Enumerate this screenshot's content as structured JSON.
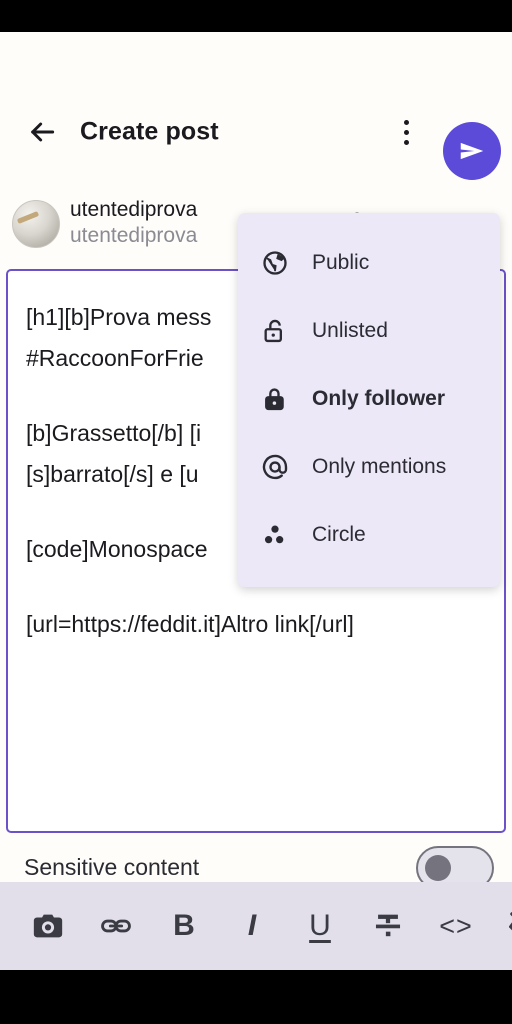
{
  "app": {
    "title": "Create post"
  },
  "appbar": {
    "back_icon": "arrow-left-icon",
    "overflow_icon": "more-vertical-icon",
    "send_icon": "send-icon"
  },
  "account": {
    "display_name": "utentediprova",
    "handle": "utentediprova",
    "avatar_icon": "user-avatar"
  },
  "visibility": {
    "selected_label": "Unlisted",
    "lock_icon": "lock-open-icon",
    "caret_icon": "chevron-down-icon",
    "options": [
      {
        "label": "Public",
        "icon": "globe-icon",
        "selected": false
      },
      {
        "label": "Unlisted",
        "icon": "lock-open-icon",
        "selected": false
      },
      {
        "label": "Only follower",
        "icon": "lock-icon",
        "selected": true
      },
      {
        "label": "Only mentions",
        "icon": "at-icon",
        "selected": false
      },
      {
        "label": "Circle",
        "icon": "circle-dots-icon",
        "selected": false
      }
    ]
  },
  "editor": {
    "lines": [
      "[h1][b]Prova mess",
      "#RaccoonForFrie",
      "",
      "[b]Grassetto[/b] [i",
      "[s]barrato[/s] e [u",
      "",
      "[code]Monospace",
      "",
      "[url=https://feddit.it]Altro link[/url]"
    ]
  },
  "sensitive": {
    "label": "Sensitive content",
    "enabled": false
  },
  "toolbar": {
    "buttons": [
      {
        "name": "camera-icon",
        "label": ""
      },
      {
        "name": "link-icon",
        "label": ""
      },
      {
        "name": "bold-icon",
        "label": "B"
      },
      {
        "name": "italic-icon",
        "label": "I"
      },
      {
        "name": "underline-icon",
        "label": "U"
      },
      {
        "name": "strikethrough-icon",
        "label": ""
      },
      {
        "name": "code-icon",
        "label": "<>"
      },
      {
        "name": "eye-off-icon",
        "label": ""
      }
    ]
  },
  "colors": {
    "accent": "#5B4BD8",
    "editor_border": "#6B52C9",
    "dropdown_bg": "#ECE8F7",
    "toolbar_bg": "#E2DFEA",
    "page_bg": "#FFFDF9"
  }
}
